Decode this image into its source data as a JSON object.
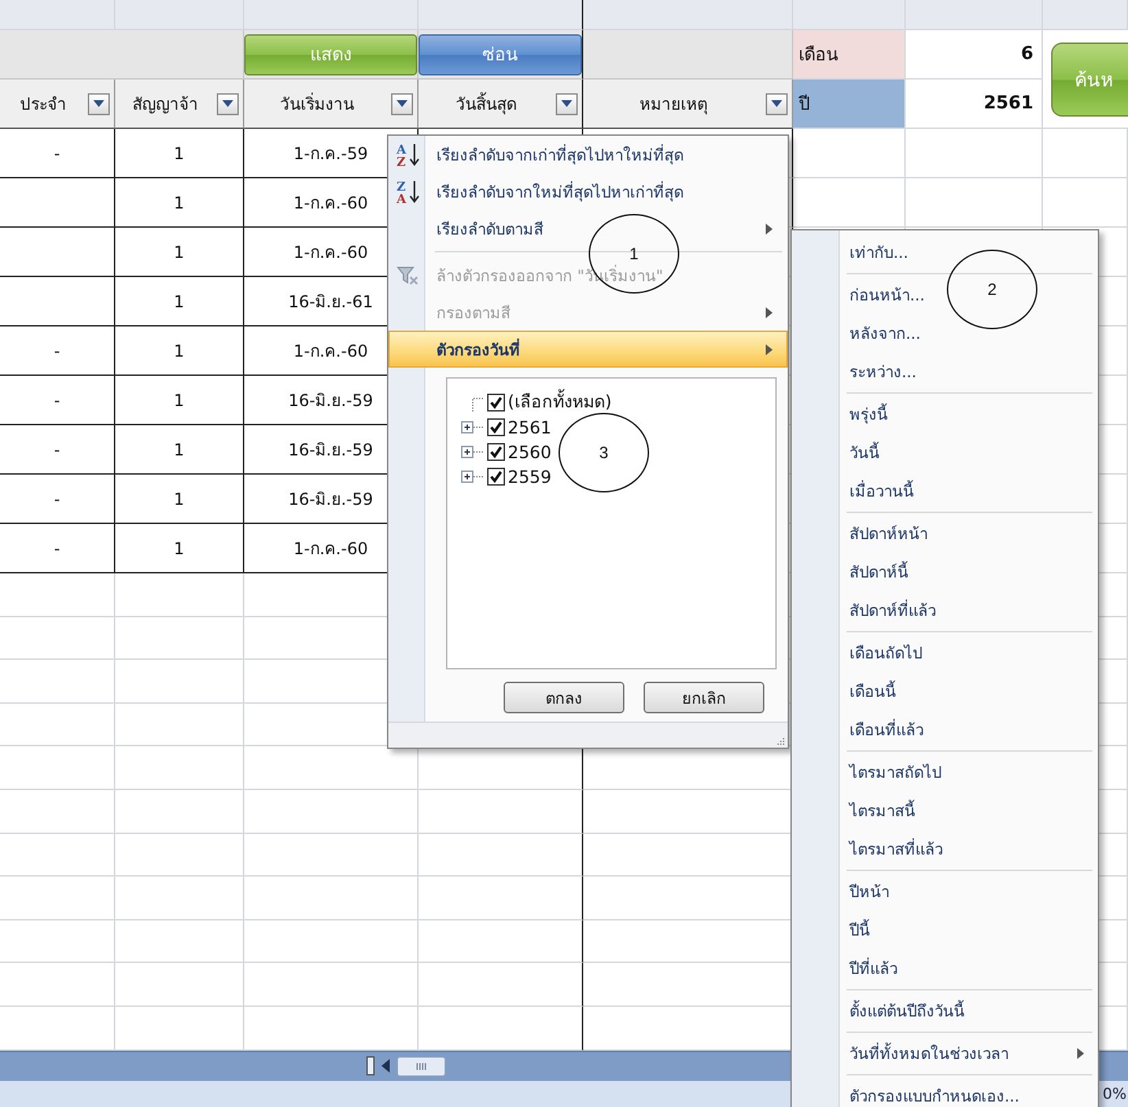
{
  "toolbar_buttons": [
    {
      "label": "แสดง",
      "kind": "green"
    },
    {
      "label": "ซ่อน",
      "kind": "blue"
    }
  ],
  "lookup": {
    "month_label": "เดือน",
    "month_value": "6",
    "year_label": "ปี",
    "year_value": "2561",
    "search_button": "ค้นห"
  },
  "table": {
    "columns": [
      {
        "label": "ประจำ"
      },
      {
        "label": "สัญญาจ้า"
      },
      {
        "label": "วันเริ่มงาน"
      },
      {
        "label": "วันสิ้นสุด"
      },
      {
        "label": "หมายเหตุ"
      }
    ],
    "rows": [
      {
        "col_1": "-",
        "col_2": "1",
        "col_3": "1-ก.ค.-59"
      },
      {
        "col_2": "1",
        "col_3": "1-ก.ค.-60"
      },
      {
        "col_2": "1",
        "col_3": "1-ก.ค.-60"
      },
      {
        "col_2": "1",
        "col_3": "16-มิ.ย.-61"
      },
      {
        "col_1": "-",
        "col_2": "1",
        "col_3": "1-ก.ค.-60"
      },
      {
        "col_1": "-",
        "col_2": "1",
        "col_3": "16-มิ.ย.-59"
      },
      {
        "col_1": "-",
        "col_2": "1",
        "col_3": "16-มิ.ย.-59"
      },
      {
        "col_1": "-",
        "col_2": "1",
        "col_3": "16-มิ.ย.-59"
      },
      {
        "col_1": "-",
        "col_2": "1",
        "col_3": "1-ก.ค.-60"
      }
    ]
  },
  "filter_menu": {
    "items": [
      {
        "kind": "sort_ascending",
        "icon_letters": [
          "A",
          "Z"
        ],
        "label": "เรียงลำดับจากเก่าที่สุดไปหาใหม่ที่สุด",
        "disabled": false,
        "has_submenu": false,
        "selected": false
      },
      {
        "kind": "sort_descending",
        "icon_letters": [
          "Z",
          "A"
        ],
        "label": "เรียงลำดับจากใหม่ที่สุดไปหาเก่าที่สุด",
        "disabled": false,
        "has_submenu": false,
        "selected": false
      },
      {
        "kind": "command",
        "label": "เรียงลำดับตามสี",
        "disabled": false,
        "has_submenu": true,
        "selected": false
      },
      {
        "kind": "separator"
      },
      {
        "kind": "clear_filter",
        "label": "ล้างตัวกรองออกจาก \"วันเริ่มงาน\"",
        "disabled": true,
        "has_submenu": false,
        "selected": false
      },
      {
        "kind": "command",
        "label": "กรองตามสี",
        "disabled": true,
        "has_submenu": true,
        "selected": false
      },
      {
        "kind": "command",
        "label": "ตัวกรองวันที่",
        "disabled": false,
        "has_submenu": true,
        "selected": true
      }
    ],
    "tree": [
      {
        "label": "(เลือกทั้งหมด)",
        "checked": true
      },
      {
        "label": "2561",
        "checked": true,
        "expanded": false
      },
      {
        "label": "2560",
        "checked": true,
        "expanded": false
      },
      {
        "label": "2559",
        "checked": true,
        "expanded": false
      }
    ],
    "buttons": [
      "ตกลง",
      "ยกเลิก"
    ]
  },
  "date_filter_menu": {
    "groups": [
      [
        {
          "kind": "command",
          "label": "เท่ากับ..."
        }
      ],
      [
        {
          "kind": "command",
          "label": "ก่อนหน้า..."
        },
        {
          "kind": "command",
          "label": "หลังจาก..."
        },
        {
          "kind": "command",
          "label": "ระหว่าง..."
        }
      ],
      [
        {
          "kind": "command",
          "label": "พรุ่งนี้"
        },
        {
          "kind": "command",
          "label": "วันนี้"
        },
        {
          "kind": "command",
          "label": "เมื่อวานนี้"
        }
      ],
      [
        {
          "kind": "command",
          "label": "สัปดาห์หน้า"
        },
        {
          "kind": "command",
          "label": "สัปดาห์นี้"
        },
        {
          "kind": "command",
          "label": "สัปดาห์ที่แล้ว"
        }
      ],
      [
        {
          "kind": "command",
          "label": "เดือนถัดไป"
        },
        {
          "kind": "command",
          "label": "เดือนนี้"
        },
        {
          "kind": "command",
          "label": "เดือนที่แล้ว"
        }
      ],
      [
        {
          "kind": "command",
          "label": "ไตรมาสถัดไป"
        },
        {
          "kind": "command",
          "label": "ไตรมาสนี้"
        },
        {
          "kind": "command",
          "label": "ไตรมาสที่แล้ว"
        }
      ],
      [
        {
          "kind": "command",
          "label": "ปีหน้า"
        },
        {
          "kind": "command",
          "label": "ปีนี้"
        },
        {
          "kind": "command",
          "label": "ปีที่แล้ว"
        }
      ],
      [
        {
          "kind": "command",
          "label": "ตั้งแต่ต้นปีถึงวันนี้"
        }
      ],
      [
        {
          "kind": "submenu",
          "label": "วันที่ทั้งหมดในช่วงเวลา"
        }
      ],
      [
        {
          "kind": "command",
          "label": "ตัวกรองแบบกำหนดเอง..."
        }
      ]
    ]
  },
  "annotations": [
    {
      "label": "1"
    },
    {
      "label": "2"
    },
    {
      "label": "3"
    }
  ],
  "status_bar": {
    "zoom": "0%"
  }
}
